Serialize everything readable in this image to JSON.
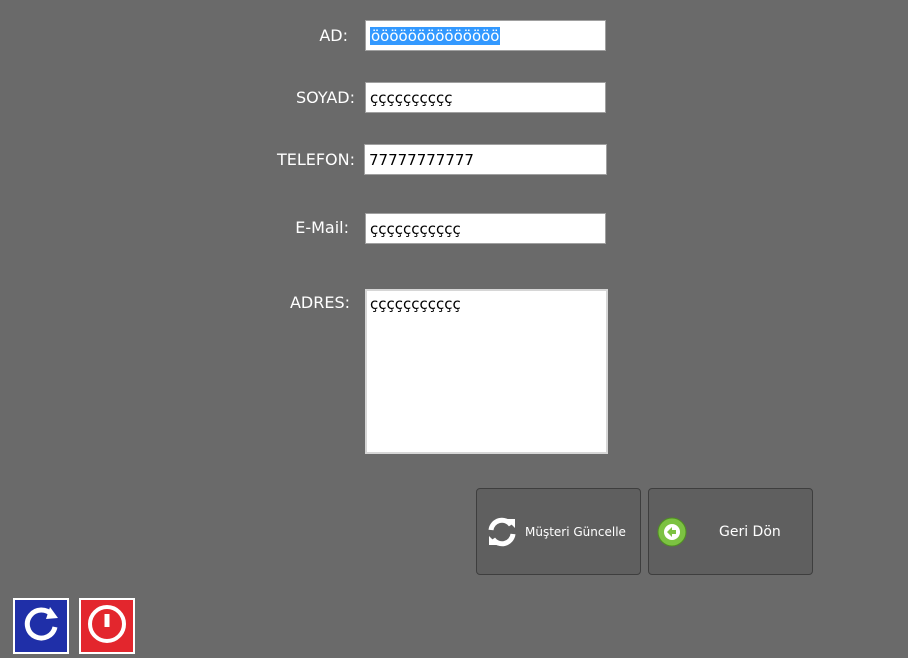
{
  "form": {
    "ad": {
      "label": "AD:",
      "value": "öööööööööööööö"
    },
    "soyad": {
      "label": "SOYAD:",
      "value": "çççççççççç"
    },
    "telefon": {
      "label": "TELEFON:",
      "value": "77777777777"
    },
    "email": {
      "label": "E-Mail:",
      "value": "ççççççççççç"
    },
    "adres": {
      "label": "ADRES:",
      "value": "ççççççççççç"
    }
  },
  "buttons": {
    "update": {
      "label": "Müşteri Güncelle",
      "icon": "refresh-icon"
    },
    "back": {
      "label": "Geri Dön",
      "icon": "arrow-left-circle-icon"
    }
  },
  "corner_buttons": {
    "refresh": {
      "icon": "refresh-icon",
      "color": "#1f2fa8"
    },
    "power": {
      "icon": "power-icon",
      "color": "#e3262d"
    }
  }
}
